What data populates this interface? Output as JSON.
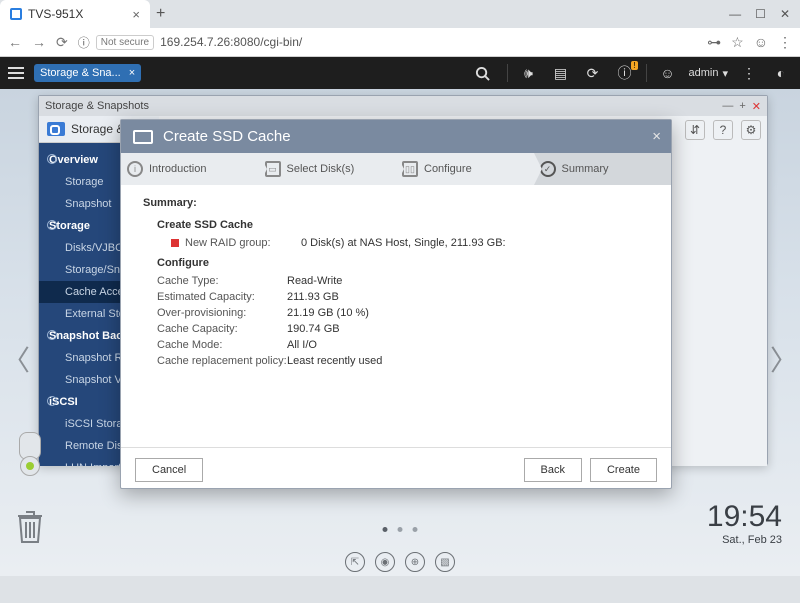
{
  "browser": {
    "tab_title": "TVS-951X",
    "not_secure": "Not secure",
    "url": "169.254.7.26:8080/cgi-bin/"
  },
  "qts": {
    "task_chip": "Storage & Sna...",
    "user": "admin"
  },
  "window": {
    "title": "Storage & Snapshots",
    "brand": "Storage &",
    "menu": {
      "overview": "Overview",
      "storage_item": "Storage",
      "snapshot_item": "Snapshot",
      "storage_hdr": "Storage",
      "disks": "Disks/VJBOD",
      "storage_snap": "Storage/Snap",
      "cache_accel": "Cache Acceler",
      "external": "External Stora",
      "snap_backup": "Snapshot Bac",
      "snap_rep": "Snapshot Rep",
      "snap_vault": "Snapshot Vaul",
      "iscsi": "iSCSI",
      "iscsi_storage": "iSCSI Storage",
      "remote_disk": "Remote Disk",
      "lun": "LUN Import/E"
    }
  },
  "wizard": {
    "title": "Create SSD Cache",
    "steps": {
      "intro": "Introduction",
      "disks": "Select Disk(s)",
      "config": "Configure",
      "summary": "Summary"
    },
    "body": {
      "summary_title": "Summary:",
      "create_title": "Create SSD Cache",
      "new_raid_lbl": "New RAID group:",
      "new_raid_val": "0 Disk(s) at NAS Host, Single, 211.93 GB:",
      "configure_title": "Configure",
      "rows": {
        "cache_type_lbl": "Cache Type:",
        "cache_type_val": "Read-Write",
        "est_cap_lbl": "Estimated Capacity:",
        "est_cap_val": "211.93 GB",
        "overprov_lbl": "Over-provisioning:",
        "overprov_val": "21.19 GB (10 %)",
        "cache_cap_lbl": "Cache Capacity:",
        "cache_cap_val": "190.74 GB",
        "cache_mode_lbl": "Cache Mode:",
        "cache_mode_val": "All I/O",
        "policy_lbl": "Cache replacement policy:",
        "policy_val": "Least recently used"
      }
    },
    "buttons": {
      "cancel": "Cancel",
      "back": "Back",
      "create": "Create"
    }
  },
  "clock": {
    "time": "19:54",
    "date": "Sat., Feb 23"
  }
}
